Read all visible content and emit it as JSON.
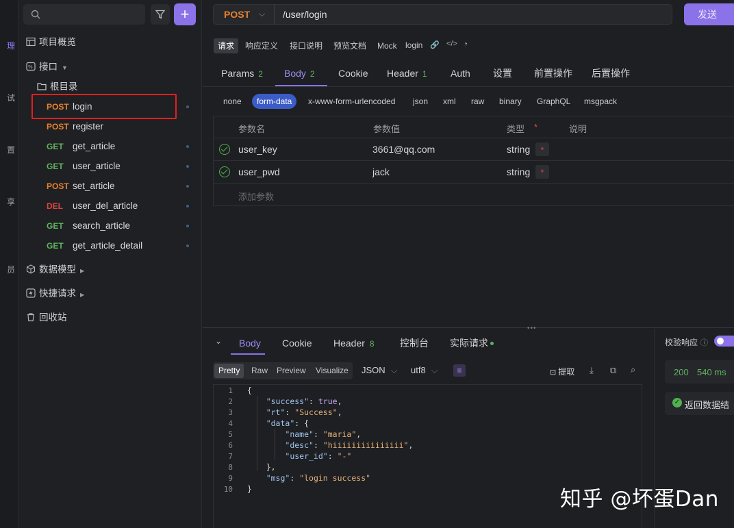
{
  "rail": {
    "items": [
      "理",
      "试",
      "置",
      "享",
      "员"
    ]
  },
  "sidebar": {
    "search_placeholder": "",
    "add_label": "+",
    "links": {
      "overview": "项目概览",
      "interfaces": "接口",
      "models": "数据模型",
      "quick": "快捷请求",
      "trash": "回收站"
    },
    "root_folder": "根目录",
    "apis": [
      {
        "method": "POST",
        "name": "login"
      },
      {
        "method": "POST",
        "name": "register"
      },
      {
        "method": "GET",
        "name": "get_article"
      },
      {
        "method": "GET",
        "name": "user_article"
      },
      {
        "method": "POST",
        "name": "set_article"
      },
      {
        "method": "DEL",
        "name": "user_del_article"
      },
      {
        "method": "GET",
        "name": "search_article"
      },
      {
        "method": "GET",
        "name": "get_article_detail"
      }
    ]
  },
  "request": {
    "method": "POST",
    "url": "/user/login",
    "send_label": "发送"
  },
  "subtabs": [
    "请求",
    "响应定义",
    "接口说明",
    "预览文档",
    "Mock"
  ],
  "api_name": "login",
  "main_tabs": {
    "params": "Params",
    "params_count": "2",
    "body": "Body",
    "body_count": "2",
    "cookie": "Cookie",
    "header": "Header",
    "header_count": "1",
    "auth": "Auth",
    "settings": "设置",
    "pre": "前置操作",
    "post": "后置操作"
  },
  "body_types": [
    "none",
    "form-data",
    "x-www-form-urlencoded",
    "json",
    "xml",
    "raw",
    "binary",
    "GraphQL",
    "msgpack"
  ],
  "table": {
    "headers": {
      "name": "参数名",
      "value": "参数值",
      "type": "类型",
      "required": "*",
      "desc": "说明"
    },
    "rows": [
      {
        "name": "user_key",
        "value": "3661@qq.com",
        "type": "string",
        "required": "*"
      },
      {
        "name": "user_pwd",
        "value": "jack",
        "type": "string",
        "required": "*"
      }
    ],
    "add_placeholder": "添加参数"
  },
  "response": {
    "tabs": {
      "body": "Body",
      "cookie": "Cookie",
      "header": "Header",
      "header_count": "8",
      "console": "控制台",
      "actual": "实际请求"
    },
    "views": [
      "Pretty",
      "Raw",
      "Preview",
      "Visualize"
    ],
    "format": "JSON",
    "encoding": "utf8",
    "extract_label": "提取",
    "code_lines": [
      "1",
      "2",
      "3",
      "4",
      "5",
      "6",
      "7",
      "8",
      "9",
      "10"
    ],
    "json": {
      "success_key": "\"success\"",
      "success_val": "true",
      "rt_key": "\"rt\"",
      "rt_val": "\"Success\"",
      "data_key": "\"data\"",
      "name_key": "\"name\"",
      "name_val": "\"maria\"",
      "desc_key": "\"desc\"",
      "desc_val": "\"hiiiiiiiiiiiiiii\"",
      "uid_key": "\"user_id\"",
      "uid_val": "\"-\"",
      "msg_key": "\"msg\"",
      "msg_val": "\"login success\""
    },
    "validate_label": "校验响应",
    "status_code": "200",
    "time": "540 ms",
    "assert_label": "返回数据结"
  },
  "watermark": "知乎 @坏蛋Dan",
  "colors": {
    "accent": "#8b72e8",
    "post": "#e8822e",
    "get": "#5fb35f",
    "del": "#e0453e"
  }
}
